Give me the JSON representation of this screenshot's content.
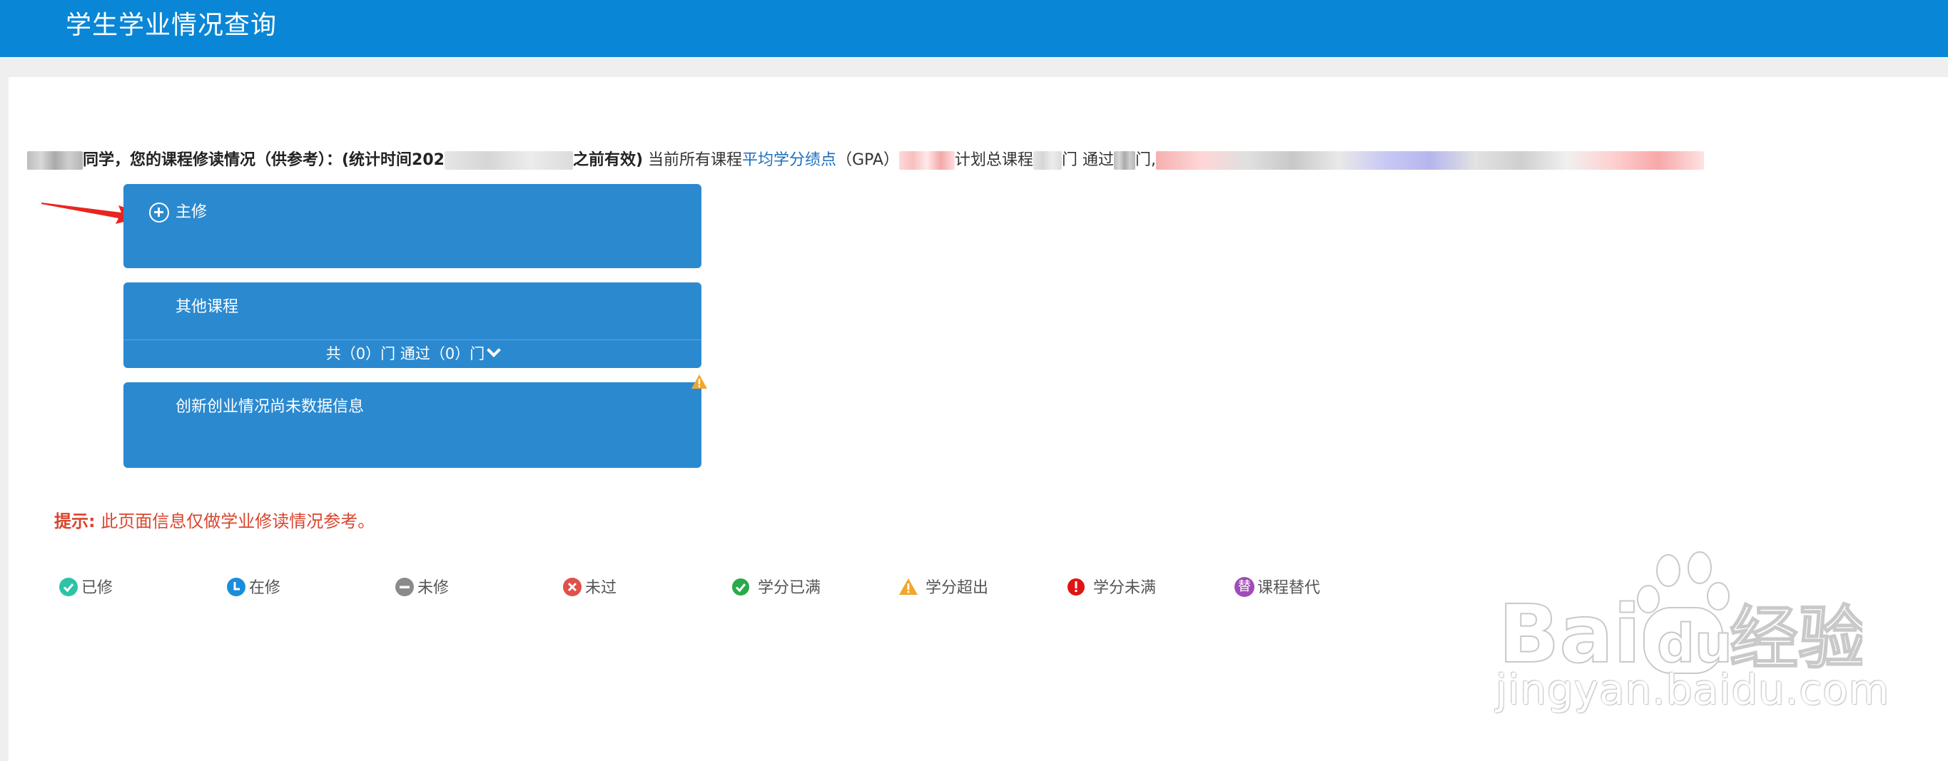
{
  "header": {
    "title": "学生学业情况查询"
  },
  "summary": {
    "student_suffix": "同学，您的课程修读情况（供参考）：(统计时间202",
    "time_suffix": "之前有效)",
    "gpa_prefix": " 当前所有课程",
    "gpa_link": "平均学分绩点",
    "gpa_suffix": "（GPA）",
    "plan_text": "计划总课程",
    "pass_text": "门 通过",
    "end_text": "门,"
  },
  "panels": {
    "major": {
      "title": "主修"
    },
    "other": {
      "title": "其他课程",
      "footer": "共（0）门  通过（0）门"
    },
    "innovation": {
      "title": "创新创业情况尚未数据信息"
    }
  },
  "tip": {
    "label": "提示:",
    "text": " 此页面信息仅做学业修读情况参考。"
  },
  "legend": [
    {
      "label": "已修",
      "icon": "check-circle",
      "color": "#2dc3a6"
    },
    {
      "label": "在修",
      "icon": "clock-circle",
      "color": "#1a8ddb"
    },
    {
      "label": "未修",
      "icon": "minus-circle",
      "color": "#8a8a8a"
    },
    {
      "label": "未过",
      "icon": "x-circle",
      "color": "#e0504c"
    },
    {
      "label": "学分已满",
      "icon": "check-circle",
      "color": "#2aaa4a"
    },
    {
      "label": "学分超出",
      "icon": "warning-triangle",
      "color": "#f2a62b"
    },
    {
      "label": "学分未满",
      "icon": "exclamation-circle",
      "color": "#e11414"
    },
    {
      "label": "课程替代",
      "icon": "substitute-circle",
      "color": "#a04bb6",
      "glyph": "替"
    }
  ],
  "watermark": {
    "url_text": "jingyan.baidu.com"
  },
  "colors": {
    "header": "#0a86d6",
    "panel": "#2b89d0",
    "tip": "#d9452e",
    "link": "#1b6fbd"
  }
}
